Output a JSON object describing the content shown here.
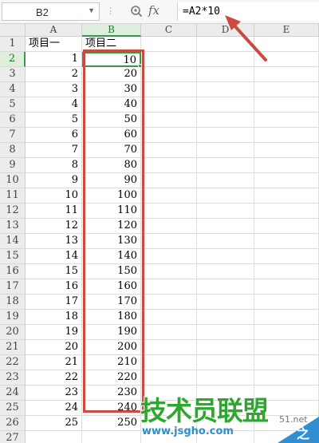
{
  "formula_bar": {
    "name_box": "B2",
    "fx_label": "fx",
    "formula": "=A2*10"
  },
  "columns": [
    "A",
    "B",
    "C",
    "D",
    "E"
  ],
  "rows": [
    {
      "row": "1",
      "a": "项目一",
      "b": "项目二"
    },
    {
      "row": "2",
      "a": "1",
      "b": "10"
    },
    {
      "row": "3",
      "a": "2",
      "b": "20"
    },
    {
      "row": "4",
      "a": "3",
      "b": "30"
    },
    {
      "row": "5",
      "a": "4",
      "b": "40"
    },
    {
      "row": "6",
      "a": "5",
      "b": "50"
    },
    {
      "row": "7",
      "a": "6",
      "b": "60"
    },
    {
      "row": "8",
      "a": "7",
      "b": "70"
    },
    {
      "row": "9",
      "a": "8",
      "b": "80"
    },
    {
      "row": "10",
      "a": "9",
      "b": "90"
    },
    {
      "row": "11",
      "a": "10",
      "b": "100"
    },
    {
      "row": "12",
      "a": "11",
      "b": "110"
    },
    {
      "row": "13",
      "a": "12",
      "b": "120"
    },
    {
      "row": "14",
      "a": "13",
      "b": "130"
    },
    {
      "row": "15",
      "a": "14",
      "b": "140"
    },
    {
      "row": "16",
      "a": "15",
      "b": "150"
    },
    {
      "row": "17",
      "a": "16",
      "b": "160"
    },
    {
      "row": "18",
      "a": "17",
      "b": "170"
    },
    {
      "row": "19",
      "a": "18",
      "b": "180"
    },
    {
      "row": "20",
      "a": "19",
      "b": "190"
    },
    {
      "row": "21",
      "a": "20",
      "b": "200"
    },
    {
      "row": "22",
      "a": "21",
      "b": "210"
    },
    {
      "row": "23",
      "a": "22",
      "b": "220"
    },
    {
      "row": "24",
      "a": "23",
      "b": "230"
    },
    {
      "row": "25",
      "a": "24",
      "b": "240"
    },
    {
      "row": "26",
      "a": "25",
      "b": "250"
    },
    {
      "row": "27",
      "a": "",
      "b": ""
    }
  ],
  "selection": {
    "active_column": "B",
    "active_row": "2"
  },
  "colors": {
    "selection": "#2e9c48",
    "annotation": "#cc4b40"
  },
  "watermark": {
    "logo": "技术员联盟",
    "url": "www.jsgho.com",
    "side": "51.net",
    "corner": "之家"
  }
}
